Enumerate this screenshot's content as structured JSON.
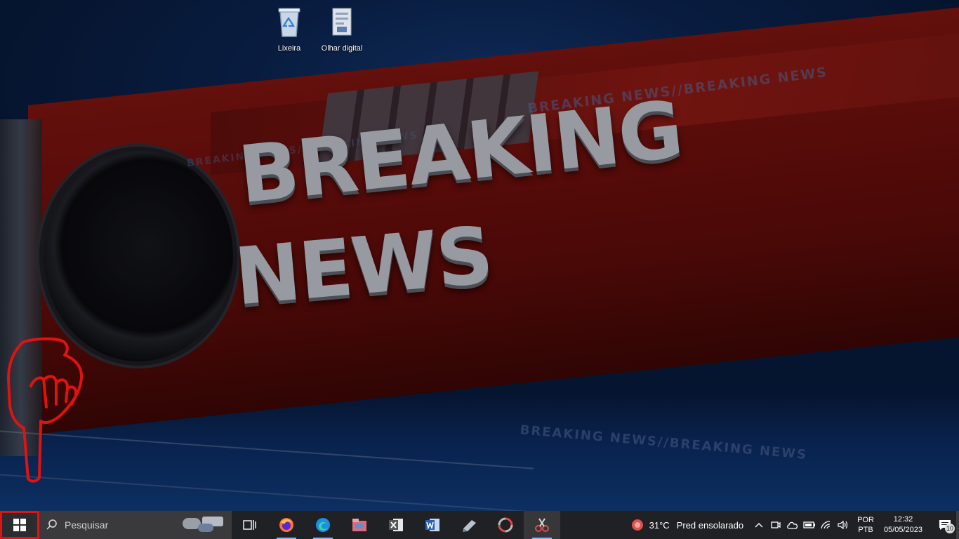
{
  "desktop": {
    "icons": [
      {
        "label": "Lixeira"
      },
      {
        "label": "Olhar digital"
      }
    ],
    "wallpaper": {
      "headline_line1": "BREAKING",
      "headline_line2": "NEWS",
      "ticker_text": "BREAKING NEWS//BREAKING NEWS"
    }
  },
  "taskbar": {
    "search_placeholder": "Pesquisar",
    "apps": [
      {
        "name": "task-view"
      },
      {
        "name": "firefox"
      },
      {
        "name": "edge"
      },
      {
        "name": "file-manager"
      },
      {
        "name": "excel"
      },
      {
        "name": "word"
      },
      {
        "name": "notepad"
      },
      {
        "name": "app-circle"
      },
      {
        "name": "snipping-tool"
      }
    ],
    "weather": {
      "temp": "31°C",
      "desc": "Pred ensolarado"
    },
    "language": {
      "line1": "POR",
      "line2": "PTB"
    },
    "clock": {
      "time": "12:32",
      "date": "05/05/2023"
    },
    "notifications": {
      "count": "10"
    }
  },
  "colors": {
    "highlight": "#e01212",
    "taskbar": "#202124"
  }
}
